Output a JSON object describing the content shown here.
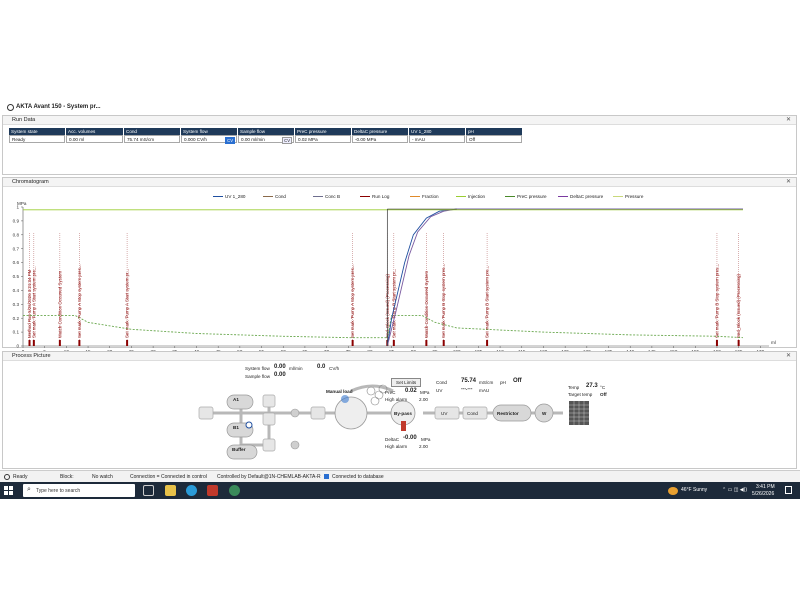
{
  "app": {
    "title": "AKTA Avant 150 - System pr..."
  },
  "run_data": {
    "title": "Run Data",
    "cells": [
      {
        "label": "System state",
        "value": "Ready",
        "unit": ""
      },
      {
        "label": "Acc. volumes",
        "value": "0.00 ml",
        "unit": ""
      },
      {
        "label": "Cond",
        "value": "75.74 mS/cm",
        "unit": ""
      },
      {
        "label": "System flow",
        "value": "0.000 CV/h",
        "unit": "CV"
      },
      {
        "label": "Sample flow",
        "value": "0.00 ml/min",
        "unit": "CV"
      },
      {
        "label": "PreC pressure",
        "value": "0.02 MPa",
        "unit": ""
      },
      {
        "label": "DeltaC pressure",
        "value": "-0.00 MPa",
        "unit": ""
      },
      {
        "label": "UV 1_280",
        "value": "- mAU",
        "unit": ""
      },
      {
        "label": "pH",
        "value": "Off",
        "unit": ""
      }
    ]
  },
  "chromatogram": {
    "title": "Chromatogram",
    "legend": [
      {
        "name": "UV 1_280",
        "color": "#1f4fa0"
      },
      {
        "name": "Cond",
        "color": "#8a6a4a"
      },
      {
        "name": "Conc B",
        "color": "#6e6e8e"
      },
      {
        "name": "Run Log",
        "color": "#8b0000"
      },
      {
        "name": "Fraction",
        "color": "#e08a2a"
      },
      {
        "name": "Injection",
        "color": "#9acd32"
      },
      {
        "name": "PreC pressure",
        "color": "#4a8a2a"
      },
      {
        "name": "DeltaC pressure",
        "color": "#7a3aa0"
      },
      {
        "name": "Pressure",
        "color": "#c8d87a"
      }
    ]
  },
  "chart_data": {
    "type": "line",
    "ylabel": "MPa",
    "xlabel": "ml",
    "xlim": [
      0,
      172
    ],
    "ylim": [
      0,
      1.0
    ],
    "xticks": [
      0,
      5,
      10,
      15,
      20,
      25,
      30,
      35,
      40,
      45,
      50,
      55,
      60,
      65,
      70,
      75,
      80,
      85,
      90,
      95,
      100,
      105,
      110,
      115,
      120,
      125,
      130,
      135,
      140,
      145,
      150,
      155,
      160,
      165,
      170
    ],
    "yticks": [
      0,
      0.1,
      0.2,
      0.3,
      0.4,
      0.5,
      0.6,
      0.7,
      0.8,
      0.9,
      1.0
    ],
    "series": [
      {
        "name": "PreC pressure",
        "color": "#6aa84f",
        "dash": true,
        "x": [
          0,
          2,
          12,
          15,
          25,
          40,
          60,
          75,
          84,
          85,
          92,
          95,
          100,
          120,
          140,
          160,
          166
        ],
        "y": [
          0.22,
          0.22,
          0.22,
          0.17,
          0.12,
          0.09,
          0.07,
          0.06,
          0.06,
          0.22,
          0.22,
          0.17,
          0.13,
          0.1,
          0.08,
          0.07,
          0.06
        ]
      },
      {
        "name": "UV 1_280",
        "color": "#1f4fa0",
        "dash": false,
        "x": [
          84,
          85,
          88,
          90,
          93,
          96,
          100,
          110,
          130,
          150,
          166
        ],
        "y": [
          0.0,
          0.2,
          0.6,
          0.8,
          0.92,
          0.97,
          0.985,
          0.985,
          0.985,
          0.985,
          0.985
        ]
      },
      {
        "name": "Conc B",
        "color": "#7a5aa0",
        "dash": false,
        "x": [
          84,
          86,
          89,
          91,
          94,
          97,
          100,
          110,
          130,
          150,
          166
        ],
        "y": [
          0.0,
          0.25,
          0.65,
          0.82,
          0.93,
          0.97,
          0.985,
          0.985,
          0.985,
          0.985,
          0.985
        ]
      },
      {
        "name": "Injection",
        "color": "#9acd32",
        "dash": false,
        "x": [
          0,
          166
        ],
        "y": [
          0.98,
          0.98
        ]
      }
    ],
    "run_log": [
      {
        "x": 1.5,
        "label": "Method Run 5/26/2026 3:21:34 PM"
      },
      {
        "x": 2.5,
        "label": "Set mark 'Pump A Start system pre..."
      },
      {
        "x": 8.5,
        "label": "Watch Condition Occurred System"
      },
      {
        "x": 13,
        "label": "Set mark 'Pump A Stop system pres..."
      },
      {
        "x": 24,
        "label": "Set mark 'Pump A Start system pr..."
      },
      {
        "x": 76,
        "label": "Set mark 'Pump A Stop system pres..."
      },
      {
        "x": 84,
        "label": "End_Block (Issued) (Processing)"
      },
      {
        "x": 85.5,
        "label": "Set mark 'Pump B Start system pr..."
      },
      {
        "x": 93,
        "label": "Watch Condition Occurred System"
      },
      {
        "x": 97,
        "label": "Set mark 'Pump B Stop system pres..."
      },
      {
        "x": 107,
        "label": "Set mark 'Pump B Start system pre..."
      },
      {
        "x": 160,
        "label": "Set mark 'Pump B Stop system pres..."
      },
      {
        "x": 165,
        "label": "End_Block (Issued) (Processing)"
      }
    ]
  },
  "process_picture": {
    "title": "Process Picture",
    "system_flow_label": "System flow",
    "system_flow_value": "0.00",
    "system_flow_unit": "ml/min",
    "system_flow_cv": "0.0",
    "system_flow_cv_unit": "CV/h",
    "sample_flow_label": "Sample flow",
    "sample_flow_value": "0.00",
    "manual_load": "Manual load",
    "set_limits": "Set Limits",
    "prec_label": "PreC",
    "prec_value": "0.02",
    "prec_unit": "MPa",
    "prec_high_label": "High alarm",
    "prec_high_value": "2.00",
    "deltac_label": "DeltaC",
    "deltac_value": "-0.00",
    "deltac_unit": "MPa",
    "deltac_high_label": "High alarm",
    "deltac_high_value": "2.00",
    "cond_label": "Cond",
    "cond_value": "75.74",
    "cond_unit": "mS/cm",
    "ph_label": "pH",
    "ph_value": "Off",
    "uv_label": "UV",
    "uv_value": "---.---",
    "uv_unit": "mAU",
    "temp_label": "Temp",
    "temp_value": "27.3",
    "temp_unit": "°C",
    "target_temp_label": "Target temp",
    "target_temp_value": "Off",
    "nodes": {
      "a1": "A1",
      "b1": "B1",
      "buffer": "Buffer",
      "bypass": "By-pass",
      "restrictor": "Restrictor",
      "w": "W",
      "uv": "UV",
      "cond": "Cond",
      "ph": "pH"
    }
  },
  "status_bar": {
    "state": "Ready",
    "block": "Block:",
    "watch": "No watch",
    "connection": "Connection = Connected in control",
    "controlled_by": "Controlled by Default@1N-CHEMLAB-AKTA-R",
    "database": "Connected to database"
  },
  "taskbar": {
    "search_placeholder": "Type here to search",
    "weather": "46°F  Sunny",
    "time": "3:41 PM",
    "date": "5/26/2026"
  }
}
